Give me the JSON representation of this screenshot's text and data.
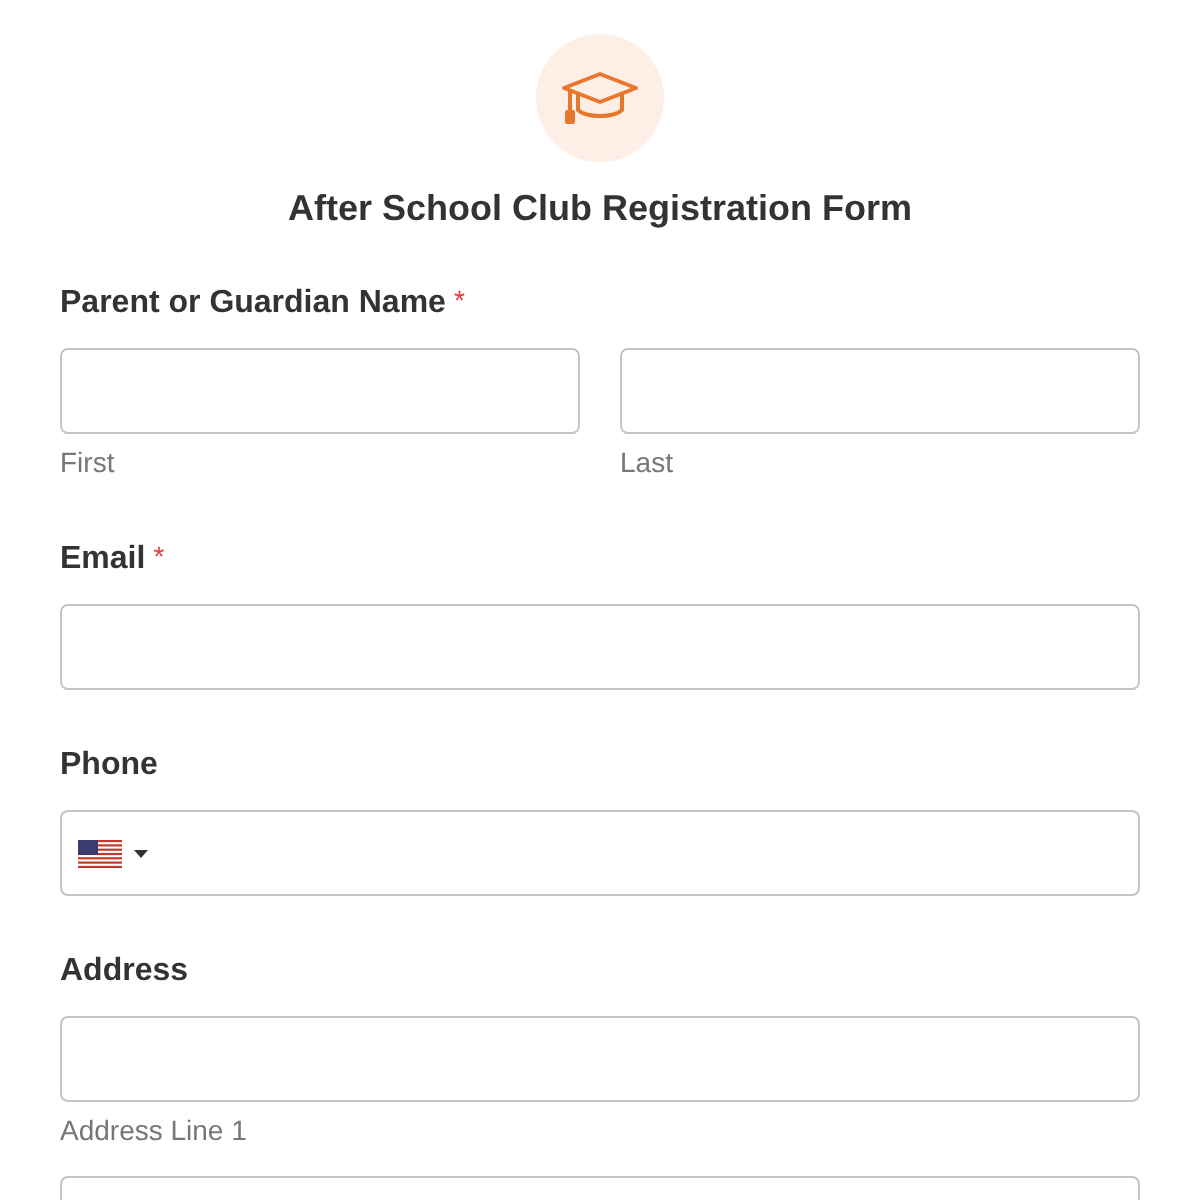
{
  "form": {
    "title": "After School Club Registration Form"
  },
  "sections": [
    {
      "label": "Parent or Guardian Name",
      "required": true,
      "kind": "name",
      "fields": [
        {
          "kind": "input",
          "sublabel": "First"
        },
        {
          "kind": "input",
          "sublabel": "Last"
        }
      ]
    },
    {
      "label": "Email",
      "required": true,
      "kind": "text",
      "fields": [
        {
          "kind": "input"
        }
      ]
    },
    {
      "label": "Phone",
      "required": false,
      "kind": "phone",
      "fields": [
        {
          "kind": "input"
        }
      ]
    },
    {
      "label": "Address",
      "required": false,
      "kind": "address",
      "fields": [
        {
          "kind": "input",
          "sublabel": "Address Line 1"
        },
        {
          "kind": "input"
        }
      ]
    }
  ],
  "required_mark": "*"
}
